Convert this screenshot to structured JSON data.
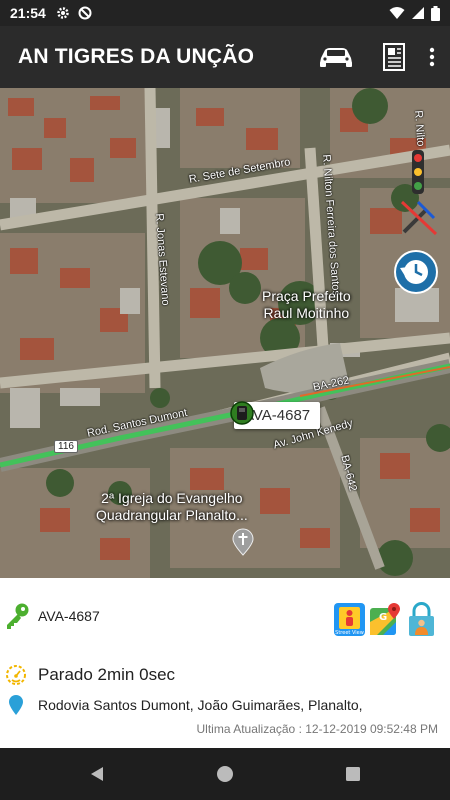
{
  "status_bar": {
    "time": "21:54"
  },
  "app_bar": {
    "title": "AN TIGRES DA UNÇÃO"
  },
  "map": {
    "streets": {
      "sete_de_setembro": "R. Sete de Setembro",
      "jonas_estevano": "R. Jonas Estevano",
      "nilton_ferreira": "R. Nilton Ferreira dos Santos",
      "nilton_right": "R. Nilto",
      "ba262": "BA-262",
      "santos_dumont": "Rod. Santos Dumont",
      "john_kenedy": "Av. John Kenedy",
      "ba642": "BA-642"
    },
    "route_shield": "116",
    "places": {
      "praca": "Praça Prefeito\nRaul Moitinho",
      "igreja": "2ª Igreja do Evangelho\nQuadrangular Planalto..."
    },
    "vehicle_tag": "AVA-4687"
  },
  "info": {
    "plate": "AVA-4687",
    "status": "Parado 2min 0sec",
    "address": "Rodovia Santos Dumont, João Guimarães, Planalto,",
    "last_update": "Ultima Atualização : 12-12-2019 09:52:48 PM",
    "street_view_caption": "Street View"
  },
  "colors": {
    "app_bar": "#2b2b2b",
    "key_green": "#4caf2f",
    "status_yellow": "#f2b600",
    "pin_blue": "#2aa0d8",
    "road_green": "#43c25a"
  }
}
